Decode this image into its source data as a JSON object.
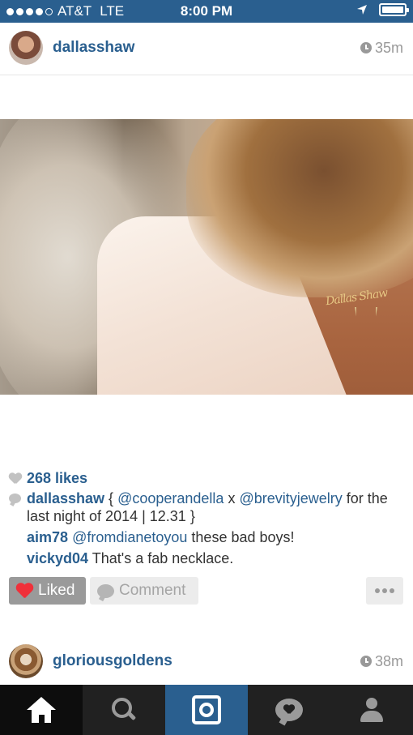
{
  "status_bar": {
    "carrier": "AT&T",
    "network": "LTE",
    "time": "8:00 PM"
  },
  "post": {
    "username": "dallasshaw",
    "time_ago": "35m",
    "likes": "268 likes",
    "caption": {
      "user": "dallasshaw",
      "text_1": " { ",
      "mention_1": "@cooperandella",
      "text_2": " x ",
      "mention_2": "@brevityjewelry",
      "text_3": " for the last night of 2014 | 12.31 }"
    },
    "comments": [
      {
        "user": "aim78",
        "mention": "@fromdianetoyou",
        "text": " these bad boys!"
      },
      {
        "user": "vickyd04",
        "text": " That's a fab necklace."
      }
    ],
    "actions": {
      "liked_label": "Liked",
      "comment_label": "Comment"
    }
  },
  "next_post": {
    "username": "gloriousgoldens",
    "time_ago": "38m"
  },
  "tab_bar": {
    "items": [
      "home-icon",
      "search-icon",
      "camera-icon",
      "activity-icon",
      "profile-icon"
    ]
  },
  "colors": {
    "brand_blue": "#2a5f8f",
    "liked_red": "#f0303a"
  }
}
